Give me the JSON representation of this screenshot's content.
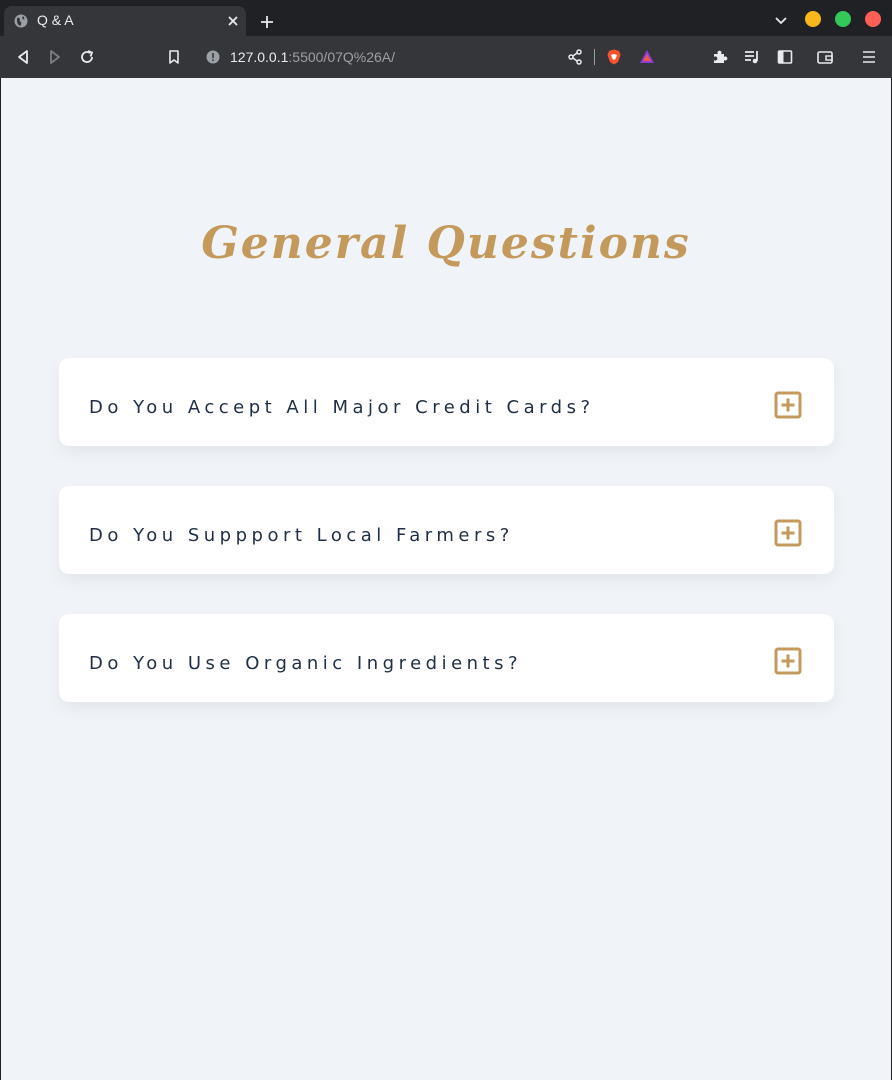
{
  "browser": {
    "tab_title": "Q & A",
    "url_host": "127.0.0.1",
    "url_path": ":5500/07Q%26A/"
  },
  "icons": {
    "tab_favicon": "globe-icon",
    "tab_close": "close-icon",
    "new_tab": "plus-icon",
    "tab_search": "chevron-down-icon",
    "back": "back-arrow-icon",
    "forward": "forward-arrow-icon",
    "reload": "reload-icon",
    "bookmark": "bookmark-icon",
    "site_info": "info-icon",
    "share": "share-icon",
    "brave_shield": "brave-lion-icon",
    "brave_rewards": "triangle-icon",
    "extensions": "puzzle-icon",
    "media": "playlist-icon",
    "sidebar": "sidebar-icon",
    "wallet": "wallet-icon",
    "menu": "hamburger-menu-icon",
    "faq_toggle": "plus-square-icon"
  },
  "colors": {
    "accent": "#c49a5c",
    "page_bg": "#f0f4f8",
    "question_text": "#1f2f45"
  },
  "page": {
    "heading": "General Questions",
    "faqs": [
      {
        "question": "Do You Accept All Major Credit Cards?"
      },
      {
        "question": "Do You Suppport Local Farmers?"
      },
      {
        "question": "Do You Use Organic Ingredients?"
      }
    ]
  }
}
